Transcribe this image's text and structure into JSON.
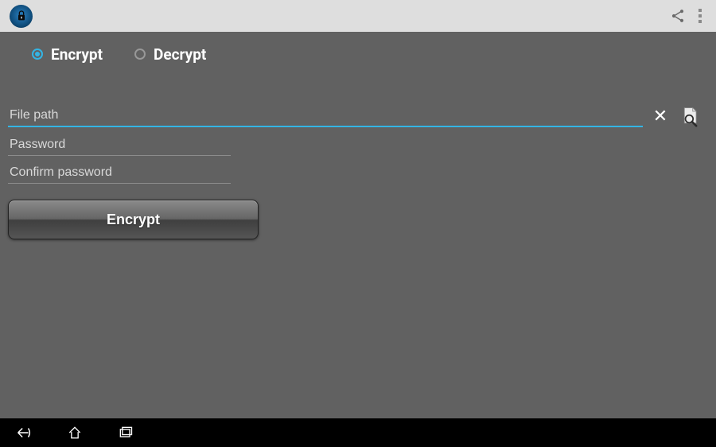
{
  "modes": {
    "encrypt_label": "Encrypt",
    "decrypt_label": "Decrypt",
    "selected": "encrypt"
  },
  "form": {
    "file_path_placeholder": "File path",
    "file_path_value": "",
    "password_placeholder": "Password",
    "password_value": "",
    "confirm_placeholder": "Confirm password",
    "confirm_value": "",
    "clear_symbol": "✕",
    "action_button_label": "Encrypt"
  },
  "icons": {
    "share": "share-icon",
    "overflow": "overflow-icon",
    "lock": "lock-icon",
    "browse": "browse-file-icon",
    "back": "back-icon",
    "home": "home-icon",
    "recents": "recents-icon"
  }
}
